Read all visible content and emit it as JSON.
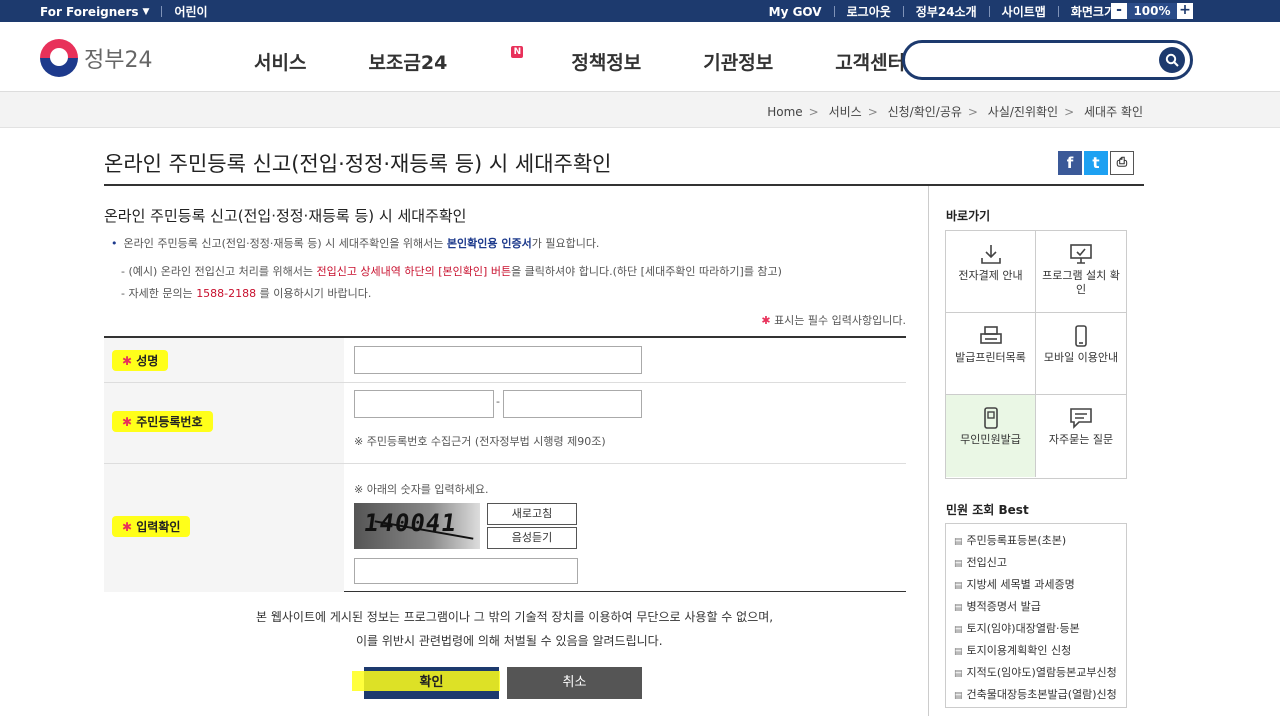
{
  "topbar": {
    "for_foreigners": "For Foreigners",
    "kids": "어린이",
    "links": [
      "My GOV",
      "로그아웃",
      "정부24소개",
      "사이트맵",
      "화면크기"
    ],
    "zoom_minus": "-",
    "zoom_value": "100%",
    "zoom_plus": "+"
  },
  "header": {
    "logo_text": "정부24",
    "nav": [
      "서비스",
      "보조금24",
      "정책정보",
      "기관정보",
      "고객센터"
    ],
    "new_badge": "N",
    "search_placeholder": ""
  },
  "breadcrumb": [
    "Home",
    "서비스",
    "신청/확인/공유",
    "사실/진위확인",
    "세대주 확인"
  ],
  "page": {
    "title": "온라인 주민등록 신고(전입·정정·재등록 등) 시 세대주확인",
    "share": [
      "f",
      "t",
      "⎙"
    ]
  },
  "content": {
    "sub_title": "온라인 주민등록 신고(전입·정정·재등록 등) 시 세대주확인",
    "note1_pre": "온라인 주민등록 신고(전입·정정·재등록 등) 시 세대주확인을 위해서는 ",
    "note1_bold": "본인확인용 인증서",
    "note1_post": "가 필요합니다.",
    "note2_pre": "- (예시) 온라인 전입신고 처리를 위해서는 ",
    "note2_red": "전입신고 상세내역 하단의 [본인확인] 버튼",
    "note2_post": "을 클릭하셔야 합니다.(하단 [세대주확인 따라하기]를 참고)",
    "note3_pre": "- 자세한 문의는 ",
    "note3_phone": "1588-2188",
    "note3_post": " 를 이용하시기 바랍니다.",
    "required_note": "표시는 필수 입력사항입니다.",
    "required_star": "✱"
  },
  "form": {
    "name_label": "성명",
    "rrn_label": "주민등록번호",
    "rrn_dash": "-",
    "rrn_note": "※ 주민등록번호 수집근거 (전자정부법 시행령 제90조)",
    "verify_label": "입력확인",
    "captcha_note": "※ 아래의 숫자를 입력하세요.",
    "captcha_text": "140041",
    "refresh_label": "새로고침",
    "audio_label": "음성듣기",
    "star": "✱"
  },
  "footer": {
    "warning_line1": "본 웹사이트에 게시된 정보는 프로그램이나 그 밖의 기술적 장치를 이용하여 무단으로 사용할 수 없으며,",
    "warning_line2": "이를 위반시 관련법령에 의해 처벌될 수 있음을 알려드립니다.",
    "confirm_label": "확인",
    "cancel_label": "취소"
  },
  "sidebar": {
    "quick_title": "바로가기",
    "quick_items": [
      "전자결제 안내",
      "프로그램 설치 확인",
      "발급프린터목록",
      "모바일 이용안내",
      "무인민원발급",
      "자주묻는 질문"
    ],
    "best_title": "민원 조회 Best",
    "best_items": [
      "주민등록표등본(초본)",
      "전입신고",
      "지방세 세목별 과세증명",
      "병적증명서 발급",
      "토지(임야)대장열람·등본",
      "토지이용계획확인 신청",
      "지적도(임야도)열람등본교부신청",
      "건축물대장등초본발급(열람)신청"
    ]
  },
  "colors": {
    "navy": "#1d3a6e",
    "accent_red": "#e8315a",
    "highlight": "#ffff1a"
  }
}
